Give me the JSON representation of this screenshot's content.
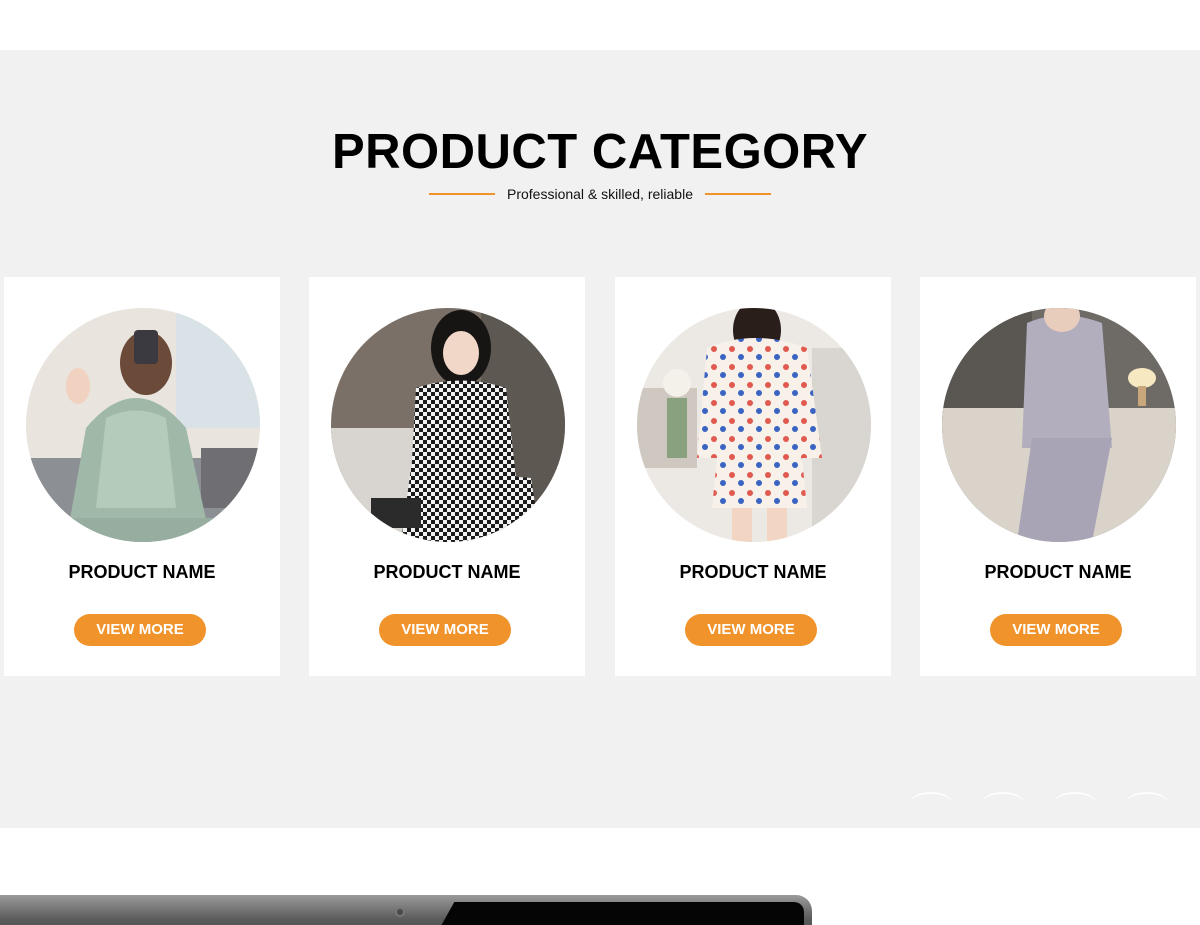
{
  "section": {
    "title": "PRODUCT CATEGORY",
    "subtitle": "Professional & skilled, reliable"
  },
  "products": [
    {
      "name": "PRODUCT NAME",
      "button": "VIEW MORE"
    },
    {
      "name": "PRODUCT NAME",
      "button": "VIEW MORE"
    },
    {
      "name": "PRODUCT NAME",
      "button": "VIEW MORE"
    },
    {
      "name": "PRODUCT NAME",
      "button": "VIEW MORE"
    }
  ],
  "colors": {
    "accent": "#f0932b",
    "section_bg": "#f1f1f1",
    "card_bg": "#ffffff"
  },
  "carousel": {
    "dot_count": 4
  }
}
